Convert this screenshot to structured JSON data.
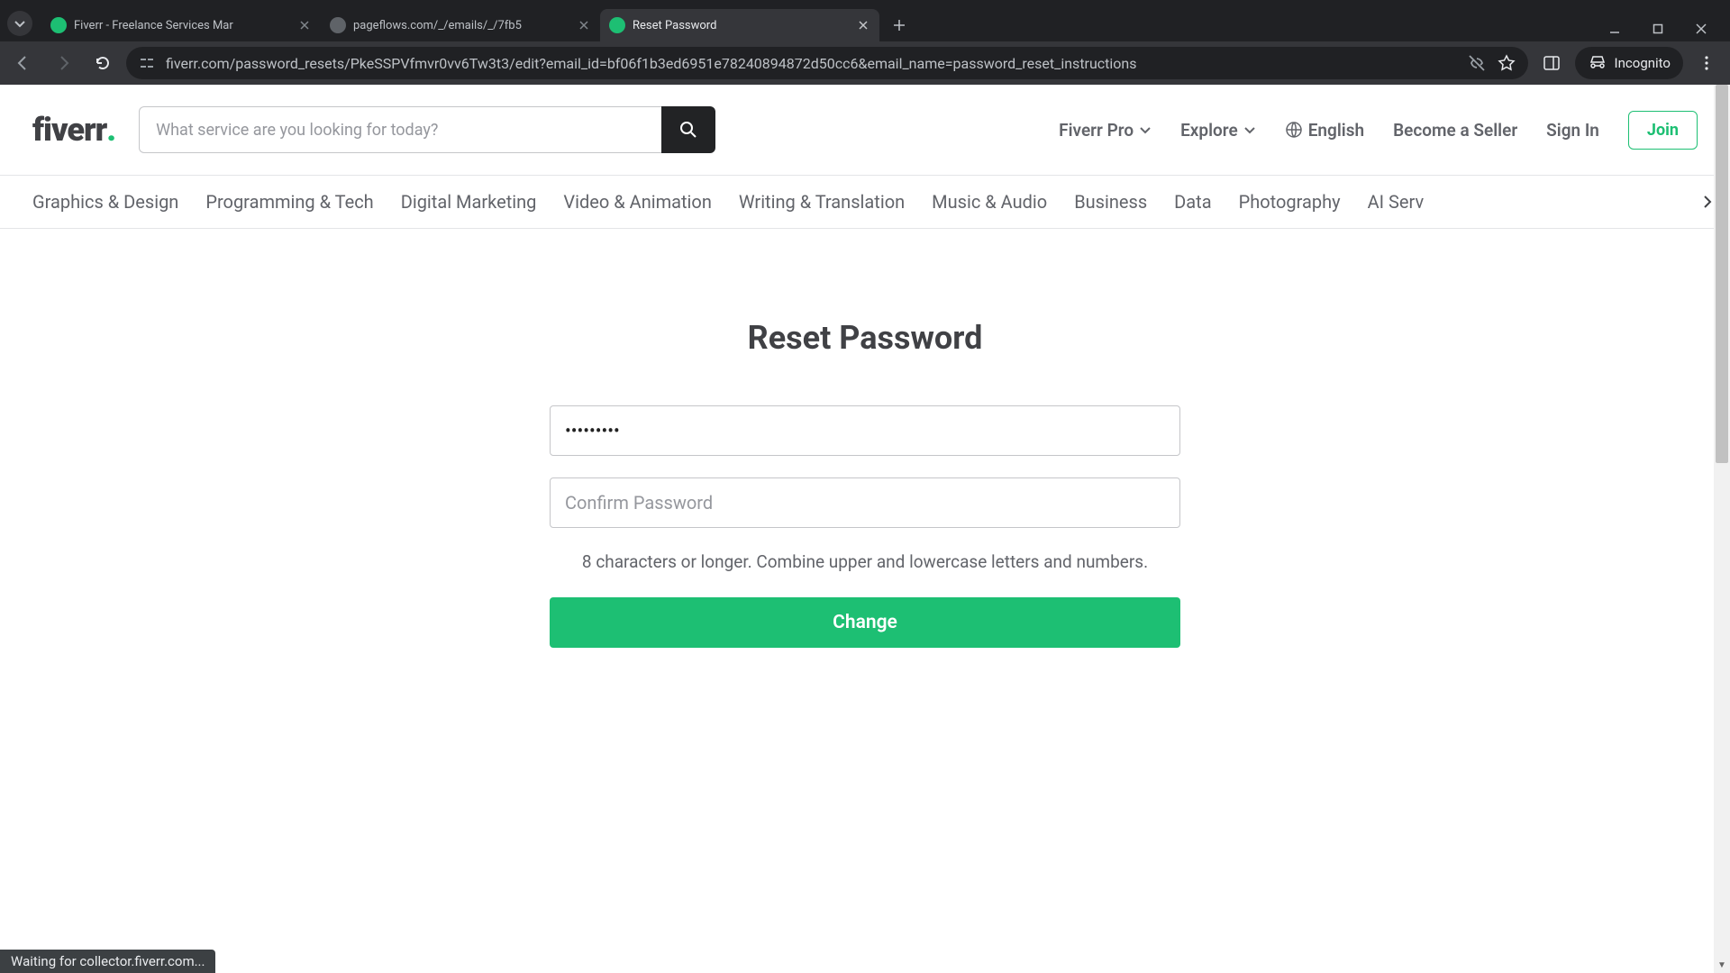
{
  "browser": {
    "tabs": [
      {
        "title": "Fiverr - Freelance Services Mar",
        "favicon": "fiverr"
      },
      {
        "title": "pageflows.com/_/emails/_/7fb5",
        "favicon": "pageflows"
      },
      {
        "title": "Reset Password",
        "favicon": "fiverr"
      }
    ],
    "url": "fiverr.com/password_resets/PkeSSPVfmvr0vv6Tw3t3/edit?email_id=bf06f1b3ed6951e78240894872d50cc6&email_name=password_reset_instructions",
    "incognito_label": "Incognito",
    "status_text": "Waiting for collector.fiverr.com..."
  },
  "header": {
    "logo_text": "fiverr",
    "logo_dot": ".",
    "search_placeholder": "What service are you looking for today?",
    "nav": {
      "fiverr_pro": "Fiverr Pro",
      "explore": "Explore",
      "language": "English",
      "become_seller": "Become a Seller",
      "sign_in": "Sign In",
      "join": "Join"
    }
  },
  "categories": [
    "Graphics & Design",
    "Programming & Tech",
    "Digital Marketing",
    "Video & Animation",
    "Writing & Translation",
    "Music & Audio",
    "Business",
    "Data",
    "Photography",
    "AI Serv"
  ],
  "reset": {
    "title": "Reset Password",
    "password_value": "•••••••••",
    "confirm_placeholder": "Confirm Password",
    "hint": "8 characters or longer. Combine upper and lowercase letters and numbers.",
    "submit_label": "Change"
  }
}
